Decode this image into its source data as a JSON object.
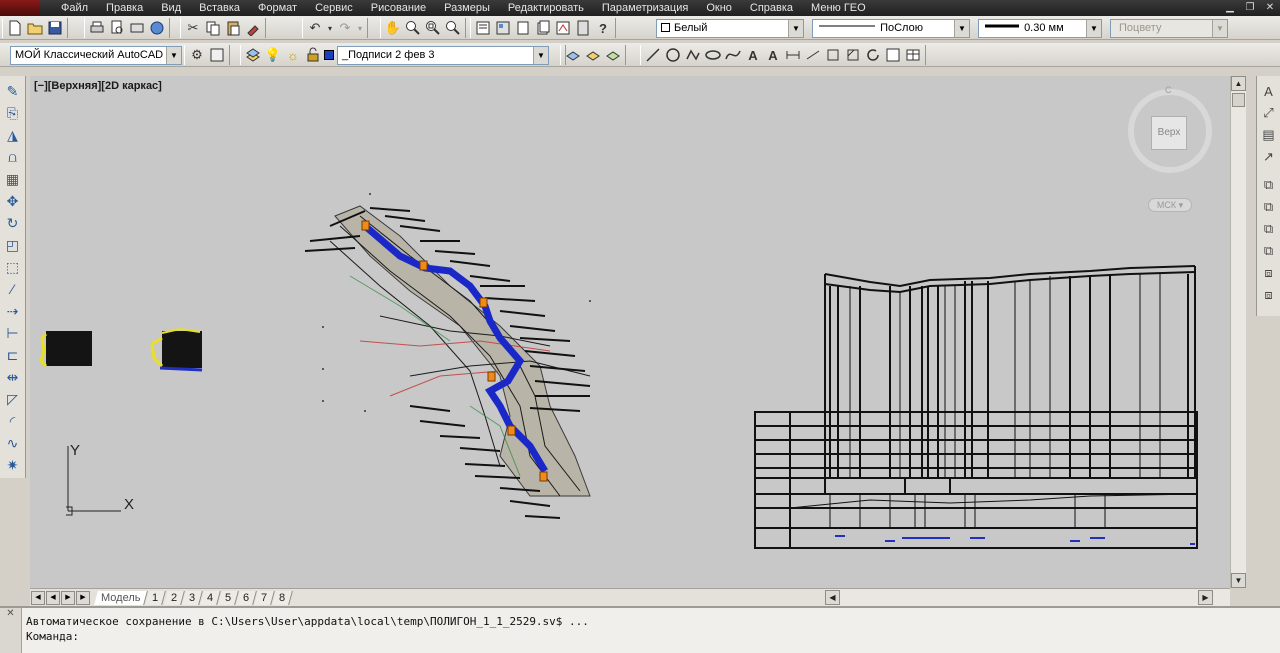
{
  "menu": {
    "items": [
      "Файл",
      "Правка",
      "Вид",
      "Вставка",
      "Формат",
      "Сервис",
      "Рисование",
      "Размеры",
      "Редактировать",
      "Параметризация",
      "Окно",
      "Справка",
      "Меню ГЕО"
    ]
  },
  "toolbar_top": {
    "color_combo": "Белый",
    "linetype_combo": "ПоСлою",
    "lineweight_combo": "0.30 мм",
    "plotstyle_combo": "Поцвету",
    "color_swatch": "#ffffff"
  },
  "toolbar_second": {
    "workspace_combo": "МОЙ Классический AutoCAD",
    "layer_combo": "_Подписи 2 фев 3",
    "layer_color": "#1a3fc0"
  },
  "viewport": {
    "label": "[−][Верхняя][2D каркас]",
    "viewcube_face": "Верх",
    "viewcube_north": "С",
    "ucs_badge": "МСК",
    "ucs_x": "X",
    "ucs_y": "Y"
  },
  "layout_tabs": [
    "Модель",
    "1",
    "2",
    "3",
    "4",
    "5",
    "6",
    "7",
    "8"
  ],
  "command": {
    "history": "Автоматическое сохранение в C:\\Users\\User\\appdata\\local\\temp\\ПОЛИГОН_1_1_2529.sv$ ...",
    "prompt": "Команда:"
  },
  "colors": {
    "background": "#c8c8c8",
    "accent_blue": "#1a28c8",
    "accent_orange": "#f08a1a",
    "yellow": "#e8e020"
  }
}
